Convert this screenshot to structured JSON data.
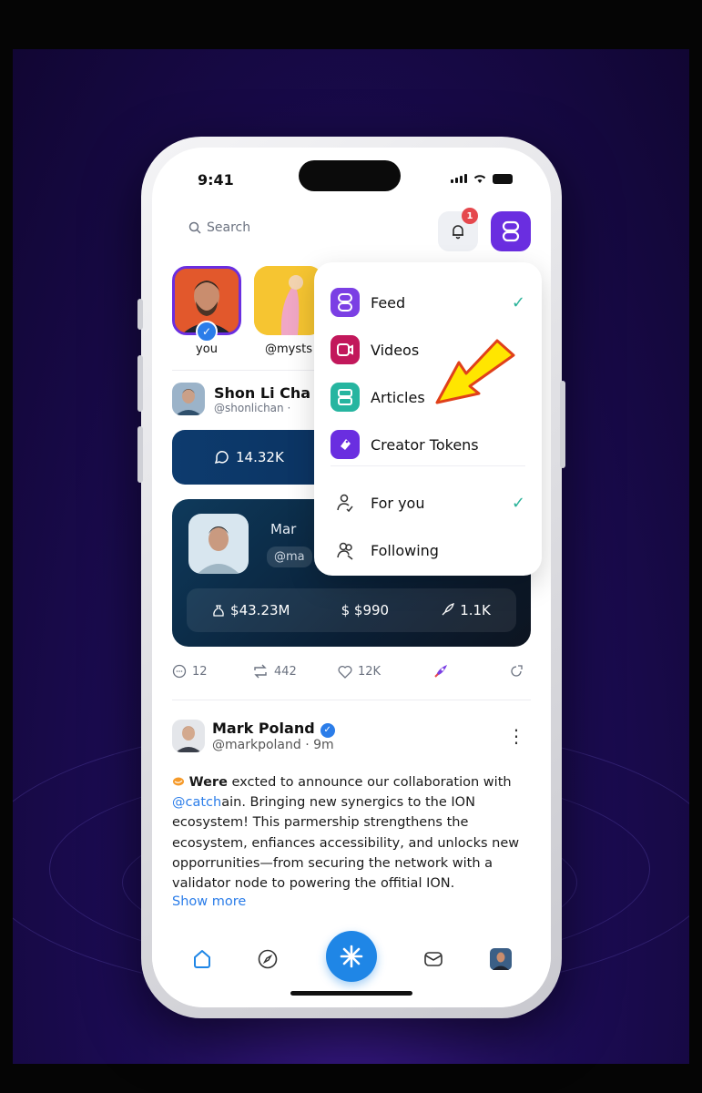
{
  "status_bar": {
    "time": "9:41"
  },
  "header": {
    "search_placeholder": "Search",
    "notification_count": "1"
  },
  "stories": [
    {
      "label": "you"
    },
    {
      "label": "@mysts"
    }
  ],
  "post1": {
    "name": "Shon Li Cha",
    "handle": "@shonlichan ·",
    "comments_count": "14.32K",
    "token_card": {
      "name": "Mar",
      "handle": "@ma",
      "market_cap": "$43.23M",
      "price": "$ $990",
      "holders": "1.1K"
    },
    "actions": {
      "replies": "12",
      "reposts": "442",
      "likes": "12K"
    }
  },
  "post2": {
    "name": "Mark Poland",
    "handle": "@markpoland",
    "time": "· 9m",
    "text_lead": "Were",
    "text_a": " excted to announce our collaboration with ",
    "mention": "@catch",
    "text_b": "ain. Bringing new synergics to the ION ecosystem! This parmership strengthens the ecosystem, enfiances accessibility, and unlocks new opporrunities—from securing the network with a validator node to powering the offitial ION.",
    "show_more": "Show more"
  },
  "dropdown": {
    "content_types": [
      {
        "label": "Feed",
        "selected": true,
        "icon": "feed-icon",
        "color": "#7b3fe4"
      },
      {
        "label": "Videos",
        "selected": false,
        "icon": "video-icon",
        "color": "#c2185b"
      },
      {
        "label": "Articles",
        "selected": false,
        "icon": "articles-icon",
        "color": "#26b5a0"
      },
      {
        "label": "Creator Tokens",
        "selected": false,
        "icon": "creator-token-icon",
        "color": "#6a2ee0"
      }
    ],
    "audience": [
      {
        "label": "For you",
        "selected": true,
        "icon": "for-you-icon"
      },
      {
        "label": "Following",
        "selected": false,
        "icon": "following-icon"
      }
    ]
  },
  "colors": {
    "accent": "#1f86e6",
    "brand": "#6a2ee0",
    "check": "#2bb39a",
    "arrow": "#ffe600"
  }
}
